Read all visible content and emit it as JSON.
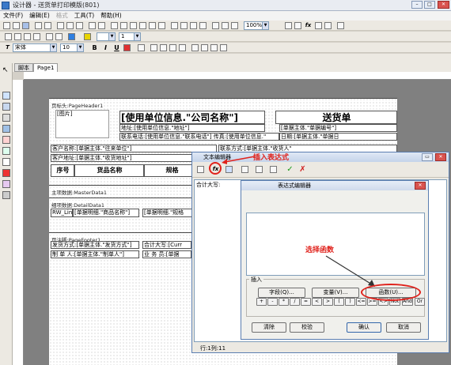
{
  "window": {
    "title": "设计器 - 送货单打印模版(801)"
  },
  "menu": [
    {
      "label": "文件(F)",
      "disabled": false
    },
    {
      "label": "编辑(E)",
      "disabled": false
    },
    {
      "label": "格式",
      "disabled": true
    },
    {
      "label": "工具(T)",
      "disabled": false
    },
    {
      "label": "帮助(H)",
      "disabled": false
    }
  ],
  "toolbar": {
    "zoom": "100%",
    "line_width": "1",
    "font_name": "宋体",
    "font_size": "10",
    "bold": "B",
    "italic": "I",
    "underline": "U",
    "function_label": "fx"
  },
  "tabs": [
    "脚本",
    "Page1"
  ],
  "report": {
    "header_band": "页标头:PageHeader1",
    "image_label": "[图片]",
    "company": "[使用单位信息.\"公司名称\"]",
    "doc_title": "送货单",
    "address": "地址:[使用单位信息.\"地址\"]",
    "contact": "联系电话:[使用单位信息.\"联系电话\"] 传真:[使用单位信息.\"",
    "doc_no": "[单据主体.\"单据编号\"]",
    "doc_date": "日期:[单据主体.\"单据日",
    "customer": "客户名称:[单据主体.\"往来单位\"]",
    "consignee": "联系方式:[单据主体.\"收货人\"",
    "cust_addr": "客户地址:[单据主体.\"收货地址\"]",
    "col_headers": [
      "序号",
      "货品名称",
      "规格"
    ],
    "master_band": "主项数据:MasterData1",
    "detail_band": "细项数据:DetailData1",
    "detail_cells": [
      "RW_Lin",
      "[单据明细.\"商品名称\"]",
      "[单据明细.\"规格"
    ],
    "footer_band": "页注脚:PageFooter1",
    "ship_method": "发货方式:[单据主体.\"发货方式\"]",
    "maker": "制 单 人:[单据主体.\"制单人\"]",
    "total_caps": "合计大写:[Curr",
    "salesman": "业 务 员:[单据"
  },
  "text_editor": {
    "title": "文本编辑器",
    "content": "合计大写:",
    "status": "行:1列:11"
  },
  "annotations": {
    "insert_expression": "插入表达式",
    "choose_function": "选择函数"
  },
  "expr_editor": {
    "title": "表达式编辑器",
    "insert_label": "插入",
    "field_btn": "字段(Q)...",
    "variable_btn": "变量(V)...",
    "function_btn": "函数(U)...",
    "operators": [
      "+",
      "-",
      "*",
      "/",
      "=",
      "<",
      ">",
      "(",
      ")",
      "<=",
      ">=",
      "<>",
      "Not",
      "And",
      "Or"
    ],
    "clear_btn": "清除",
    "check_btn": "校验",
    "ok_btn": "确认",
    "cancel_btn": "取消"
  },
  "colors": {
    "annotation": "#e0221c",
    "title_grad": "#c5d4ea"
  }
}
